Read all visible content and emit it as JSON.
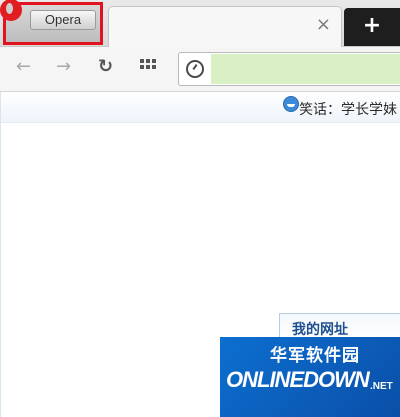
{
  "tabs": {
    "opera_label": "Opera",
    "close_glyph": "×",
    "new_tab_glyph": "+"
  },
  "toolbar": {
    "back_glyph": "←",
    "forward_glyph": "→",
    "reload_glyph": "↻",
    "address_value": ""
  },
  "page": {
    "joke_text": "笑话：学长学妹",
    "sites_title": "我的网址"
  },
  "watermark": {
    "cn": "华军软件园",
    "en": "ONLINEDOWN",
    "tld": ".NET"
  },
  "colors": {
    "highlight_border": "#e1131f",
    "address_highlight": "#d9efc4",
    "watermark_bg": "#0c6fd0"
  },
  "icons": [
    "opera-logo-icon",
    "back-arrow-icon",
    "forward-arrow-icon",
    "reload-icon",
    "speed-dial-icon",
    "site-info-icon",
    "smiley-icon"
  ]
}
